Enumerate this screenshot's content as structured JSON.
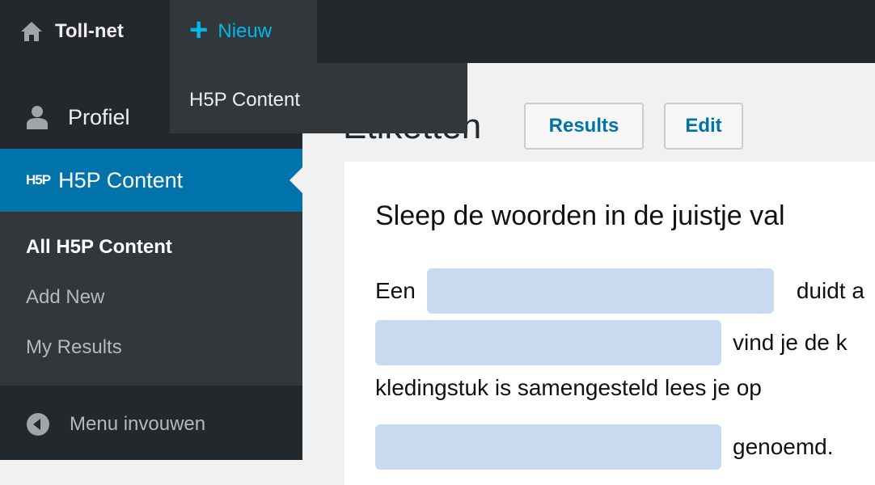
{
  "adminbar": {
    "site_name": "Toll-net",
    "new_label": "Nieuw",
    "dropdown_item": "H5P Content"
  },
  "sidebar": {
    "profiel": "Profiel",
    "h5p_logo": "H5P",
    "h5p_label": "H5P Content",
    "submenu": [
      "All H5P Content",
      "Add New",
      "My Results"
    ],
    "collapse": "Menu invouwen"
  },
  "main": {
    "title": "Etiketten",
    "results_btn": "Results",
    "edit_btn": "Edit",
    "task": "Sleep de woorden in de juistje val",
    "lines": [
      {
        "before": "Een",
        "after": "duidt a"
      },
      {
        "after": "vind je de k"
      },
      {
        "text": "kledingstuk is samengesteld lees je op"
      },
      {
        "after": "genoemd."
      }
    ]
  },
  "colors": {
    "accent": "#0073aa",
    "new_link": "#00b9eb",
    "blank": "#c8daf0",
    "bar": "#23282d"
  }
}
